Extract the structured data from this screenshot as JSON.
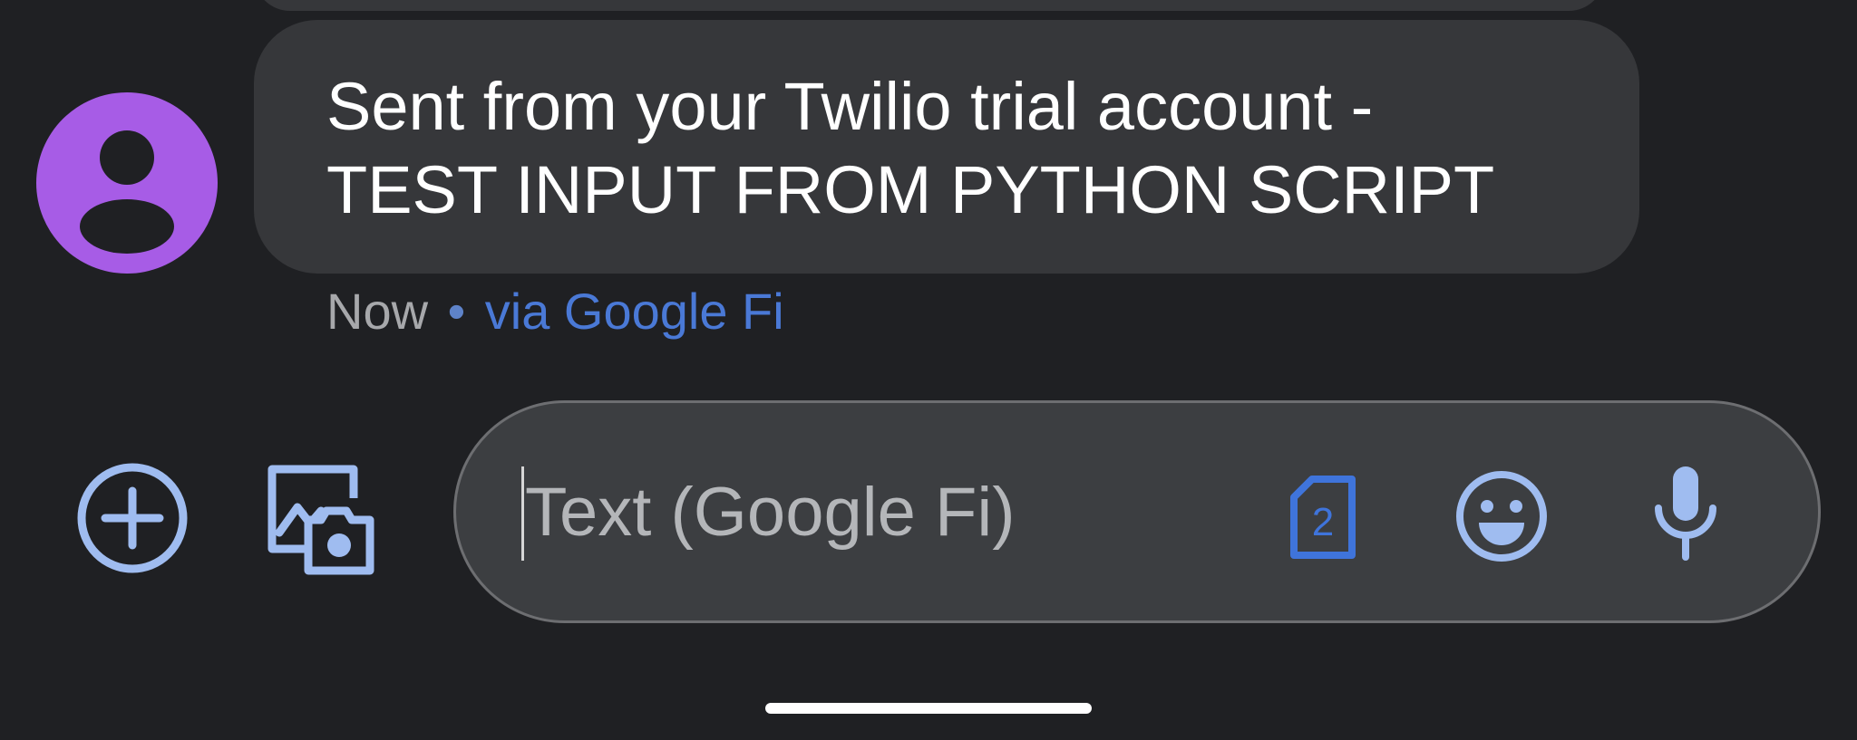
{
  "thread": {
    "message": {
      "text": "Sent from your Twilio trial account -\nTEST INPUT FROM PYTHON SCRIPT",
      "time": "Now",
      "separator": "•",
      "carrier": "via Google Fi"
    },
    "avatar": {
      "icon": "person-icon",
      "color": "#a75ce6"
    }
  },
  "composer": {
    "placeholder": "Text (Google Fi)",
    "value": "",
    "sim_label": "2",
    "icons": {
      "add": "add-circle-icon",
      "gallery": "gallery-camera-icon",
      "sim": "sim-card-icon",
      "emoji": "emoji-icon",
      "mic": "microphone-icon"
    }
  },
  "colors": {
    "background": "#1f2023",
    "bubble": "#36373a",
    "accent": "#9fbcf0",
    "link": "#4a79d6",
    "avatar": "#a75ce6"
  }
}
